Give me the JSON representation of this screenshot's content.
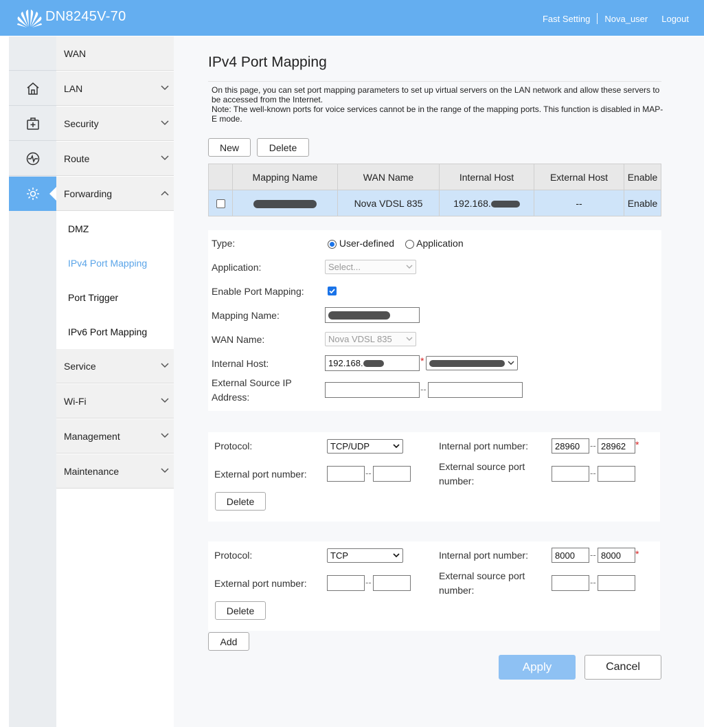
{
  "header": {
    "brand": "DN8245V-70",
    "links": [
      "Fast Setting",
      "Nova_user",
      "Logout"
    ]
  },
  "sidebar": {
    "items": [
      {
        "label": "WAN",
        "icon": ""
      },
      {
        "label": "LAN",
        "icon": "home-icon"
      },
      {
        "label": "Security",
        "icon": "medical-kit-icon"
      },
      {
        "label": "Route",
        "icon": "pulse-icon"
      },
      {
        "label": "Forwarding",
        "icon": "gear-icon"
      }
    ],
    "subitems": [
      "DMZ",
      "IPv4 Port Mapping",
      "Port Trigger",
      "IPv6 Port Mapping"
    ],
    "more_items": [
      "Service",
      "Wi-Fi",
      "Management",
      "Maintenance"
    ]
  },
  "page": {
    "title": "IPv4 Port Mapping",
    "description": "On this page, you can set port mapping parameters to set up virtual servers on the LAN network and allow these servers to be accessed from the Internet.",
    "note": "Note: The well-known ports for voice services cannot be in the range of the mapping ports. This function is disabled in MAP-E mode.",
    "new_button": "New",
    "delete_button": "Delete"
  },
  "table": {
    "headers": [
      "Mapping Name",
      "WAN Name",
      "Internal Host",
      "External Host",
      "Enable"
    ],
    "rows": [
      {
        "mapping_name": "",
        "wan_name": "Nova VDSL 835",
        "internal_host": "192.168.",
        "external_host": "--",
        "enable": "Enable"
      }
    ]
  },
  "form": {
    "type_label": "Type:",
    "type_options": [
      "User-defined",
      "Application"
    ],
    "type_selected": "User-defined",
    "application_label": "Application:",
    "application_placeholder": "Select...",
    "enable_label": "Enable Port Mapping:",
    "enable_checked": true,
    "mapping_name_label": "Mapping Name:",
    "wan_name_label": "WAN Name:",
    "wan_name_value": "Nova VDSL 835",
    "internal_host_label": "Internal Host:",
    "internal_host_value": "192.168.",
    "ext_src_label_1": "External Source IP",
    "ext_src_label_2": "Address:"
  },
  "rules": [
    {
      "protocol_label": "Protocol:",
      "protocol": "TCP/UDP",
      "internal_port_label": "Internal port number:",
      "internal_start": "28960",
      "internal_end": "28962",
      "external_port_label": "External port number:",
      "ext_src_port_label_1": "External source port",
      "ext_src_port_label_2": "number:",
      "delete_label": "Delete"
    },
    {
      "protocol_label": "Protocol:",
      "protocol": "TCP",
      "internal_port_label": "Internal port number:",
      "internal_start": "8000",
      "internal_end": "8000",
      "external_port_label": "External port number:",
      "ext_src_port_label_1": "External source port",
      "ext_src_port_label_2": "number:",
      "delete_label": "Delete"
    }
  ],
  "actions": {
    "add": "Add",
    "apply": "Apply",
    "cancel": "Cancel"
  },
  "colors": {
    "accent": "#64aef0",
    "selected_row": "#cfe4f9",
    "apply": "#8ec1f3"
  }
}
